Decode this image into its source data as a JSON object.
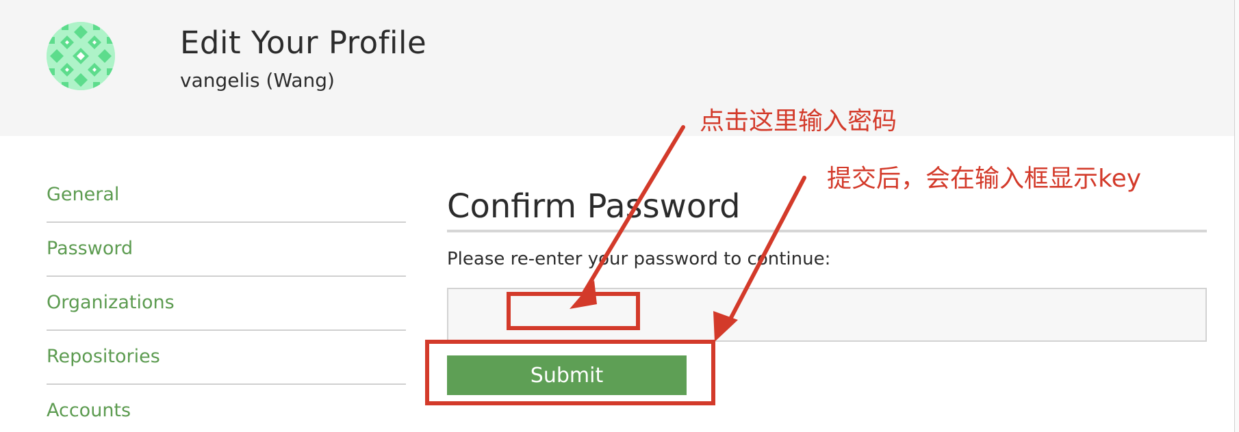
{
  "header": {
    "title": "Edit Your Profile",
    "subtitle": "vangelis (Wang)",
    "avatar_colors": {
      "primary": "#5ddc8c",
      "secondary": "#aef3c8"
    }
  },
  "sidebar": {
    "items": [
      {
        "label": "General"
      },
      {
        "label": "Password"
      },
      {
        "label": "Organizations"
      },
      {
        "label": "Repositories"
      },
      {
        "label": "Accounts"
      }
    ]
  },
  "main": {
    "section_title": "Confirm Password",
    "prompt": "Please re-enter your password to continue:",
    "password_value": "",
    "submit_label": "Submit"
  },
  "annotations": {
    "click_here_note": "点击这里输入密码",
    "submit_note": "提交后，会在输入框显示key",
    "color": "#d33a2a"
  },
  "colors": {
    "link_green": "#5c9b50",
    "button_green": "#5e9f55",
    "header_bg": "#f5f5f5"
  }
}
